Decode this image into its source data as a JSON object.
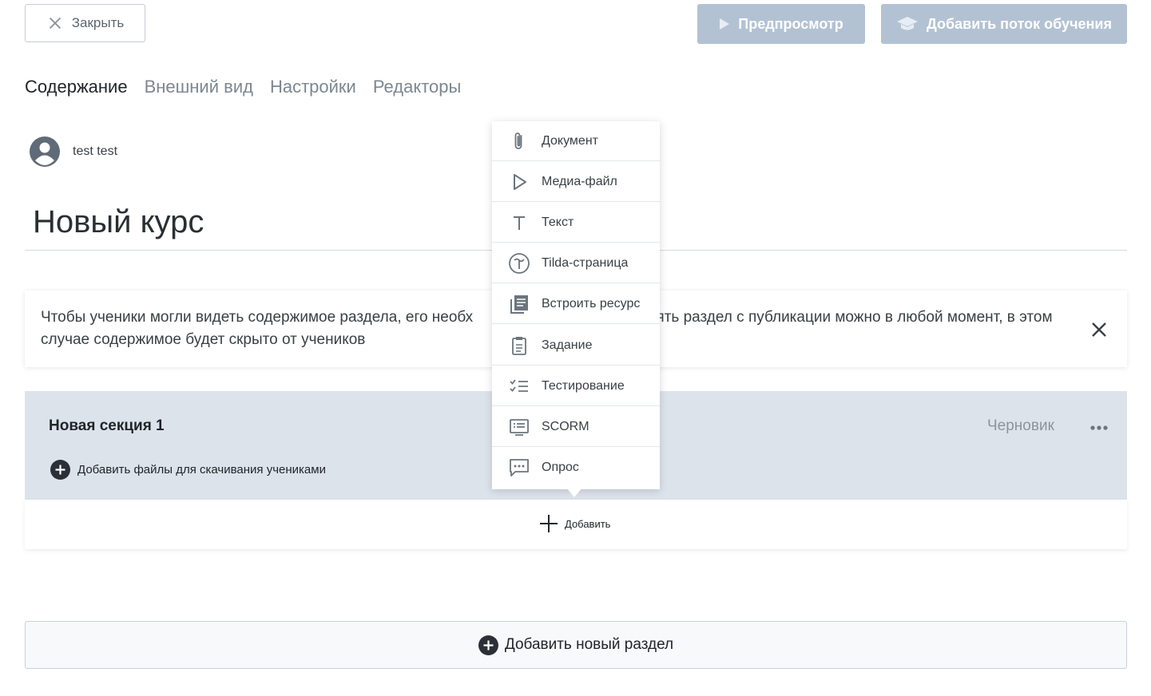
{
  "toolbar": {
    "close_label": "Закрыть",
    "preview_label": "Предпросмотр",
    "add_stream_label": "Добавить поток обучения"
  },
  "tabs": [
    {
      "label": "Содержание",
      "active": true
    },
    {
      "label": "Внешний вид",
      "active": false
    },
    {
      "label": "Настройки",
      "active": false
    },
    {
      "label": "Редакторы",
      "active": false
    }
  ],
  "author": {
    "name": "test test"
  },
  "course": {
    "title": "Новый курс"
  },
  "banner": {
    "text": "Чтобы ученики могли видеть содержимое раздела, его необх",
    "text_rest": "Снять раздел с публикации можно в любой момент, в этом случае содержимое будет скрыто от учеников"
  },
  "section": {
    "title": "Новая секция 1",
    "status": "Черновик",
    "add_files_label": "Добавить файлы для скачивания учениками",
    "add_label": "Добавить"
  },
  "add_menu": {
    "items": [
      {
        "label": "Документ",
        "icon": "paperclip-icon"
      },
      {
        "label": "Медиа-файл",
        "icon": "play-icon"
      },
      {
        "label": "Текст",
        "icon": "text-icon"
      },
      {
        "label": "Tilda-страница",
        "icon": "tilda-icon"
      },
      {
        "label": "Встроить ресурс",
        "icon": "embed-icon"
      },
      {
        "label": "Задание",
        "icon": "clipboard-icon"
      },
      {
        "label": "Тестирование",
        "icon": "checklist-icon"
      },
      {
        "label": "SCORM",
        "icon": "scorm-icon"
      },
      {
        "label": "Опрос",
        "icon": "chat-icon"
      }
    ]
  },
  "new_section_label": "Добавить новый раздел",
  "colors": {
    "primary_disabled": "#b3c2d3",
    "section_bg": "#dde3eb",
    "icon_gray": "#6c757d"
  }
}
